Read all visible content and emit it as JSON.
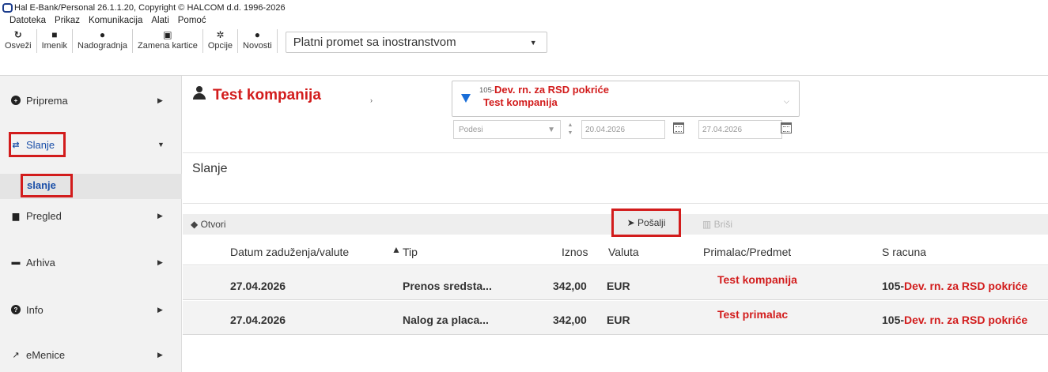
{
  "window": {
    "title": "Hal E-Bank/Personal 26.1.1.20, Copyright © HALCOM d.d. 1996-2026"
  },
  "menu": [
    "Datoteka",
    "Prikaz",
    "Komunikacija",
    "Alati",
    "Pomoć"
  ],
  "toolbar": {
    "buttons": [
      {
        "label": "Osveži",
        "icon": "refresh-icon"
      },
      {
        "label": "Imenik",
        "icon": "address-book-icon"
      },
      {
        "label": "Nadogradnja",
        "icon": "upgrade-icon"
      },
      {
        "label": "Zamena kartice",
        "icon": "card-icon"
      },
      {
        "label": "Opcije",
        "icon": "gear-icon"
      },
      {
        "label": "Novosti",
        "icon": "info-icon"
      }
    ],
    "module_select": "Platni promet sa inostranstvom"
  },
  "sidebar": {
    "items": [
      {
        "label": "Priprema",
        "icon": "circle-plus-icon"
      },
      {
        "label": "Slanje",
        "icon": "swap-icon"
      },
      {
        "label": "Pregled",
        "icon": "briefcase-icon"
      },
      {
        "label": "Arhiva",
        "icon": "archive-icon"
      },
      {
        "label": "Info",
        "icon": "question-icon"
      },
      {
        "label": "eMenice",
        "icon": "external-link-icon"
      }
    ],
    "subitem": "slanje"
  },
  "header": {
    "company": "Test kompanija",
    "account_number": "105-",
    "account_name": "Dev. rn. za RSD pokriće",
    "account_company": "Test kompanija",
    "filter_placeholder": "Podesi",
    "date_from": "20.04.2026",
    "date_to": "27.04.2026"
  },
  "section": {
    "title": "Slanje"
  },
  "actions": {
    "open": "Otvori",
    "send": "Pošalji",
    "delete": "Briši"
  },
  "table": {
    "columns": [
      "Datum zaduženja/valute",
      "Tip",
      "Iznos",
      "Valuta",
      "Primalac/Predmet",
      "S racuna"
    ],
    "rows": [
      {
        "date": "27.04.2026",
        "type": "Prenos sredsta...",
        "amount": "342,00",
        "currency": "EUR",
        "recipient": "Test kompanija",
        "account_prefix": "105-",
        "account_name": "Dev. rn. za RSD pokriće"
      },
      {
        "date": "27.04.2026",
        "type": "Nalog za placa...",
        "amount": "342,00",
        "currency": "EUR",
        "recipient": "Test primalac",
        "account_prefix": "105-",
        "account_name": "Dev. rn. za RSD pokriće"
      }
    ]
  },
  "colors": {
    "highlight": "#d21c1c",
    "accent": "#1a6ed8"
  }
}
